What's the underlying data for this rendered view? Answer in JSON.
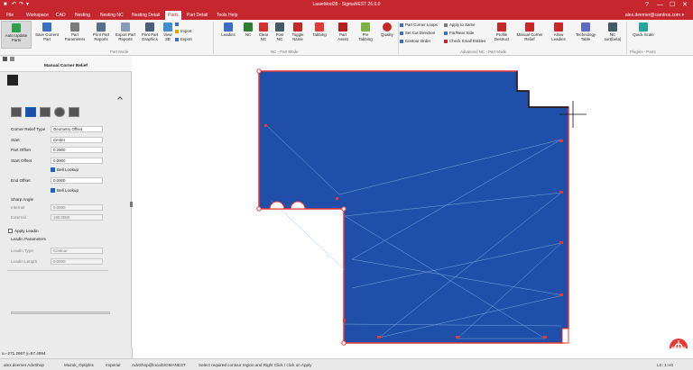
{
  "titlebar": {
    "title": "LaserMod28 - SigmaNEST 26.0.0",
    "quick_access": [
      "■",
      "↶",
      "↷",
      "▾"
    ],
    "window_controls": [
      "?",
      "—",
      "☐",
      "✕"
    ]
  },
  "menu": {
    "tabs": [
      "File",
      "Workspace",
      "CAD",
      "Nesting",
      "Nesting NC",
      "Nesting Detail",
      "Parts",
      "Part Detail",
      "Tools Help"
    ],
    "active_tab": "Parts",
    "account": "alex.deemer@camtrox.com ▾"
  },
  "ribbon": {
    "part_mode": {
      "auto_update": "Auto Update Parts",
      "save_current": "Save Current Part",
      "part_parameters": "Part Parameters",
      "print_part_reports": "Print Part Reports",
      "export_part_reports": "Export Part Reports",
      "print_part_graphics": "Print Part Graphics",
      "view_3d": "View 3D",
      "import": "Import",
      "export": "Export",
      "group_label": "Part Mode"
    },
    "nc_part_mode": {
      "leadins": "Leadins",
      "nc": "NC",
      "clear_nc": "Clear NC",
      "post_nc": "Post NC",
      "toggle_name": "Toggle Name",
      "tabbing": "Tabbing",
      "part_assist": "Part Assist",
      "pre_tabbing": "Pre Tabbing",
      "quality": "Quality",
      "group_label": "NC - Part Mode"
    },
    "advanced_nc": {
      "part_corner_loops": "Part Corner Loops",
      "set_cut_direction": "Set Cut Direction",
      "contour_order": "Contour Order",
      "apply_to_same": "Apply to Same",
      "far_near_side": "Far/Near Side",
      "check_small_entities": "Check Small Entities",
      "profile_destruct": "Profile Destruct",
      "manual_corner_relief": "Manual Corner Relief",
      "allow_leadins": "Allow Leadins",
      "technology_table": "Technology Table",
      "nc_sort_beta": "NC sort(beta)",
      "group_label": "Advanced NC - Part Mode"
    },
    "plugins": {
      "quick_scale": "Quick Scale",
      "group_label": "Plugins - Parts"
    }
  },
  "panel": {
    "title": "Manual Corner Relief",
    "corner_relief_type_label": "Corner Relief Type",
    "corner_relief_type_value": "Geometry Offset",
    "start_label": "Start",
    "start_value": "Center",
    "part_offset_label": "Part Offset",
    "part_offset_value": "0.2500",
    "start_offset_label": "Start Offset",
    "start_offset_value": "0.0000",
    "bell_lookup_label": "Bell Lookup",
    "end_offset_label": "End Offset",
    "end_offset_value": "0.0000",
    "bell_lookup2_label": "Bell Lookup",
    "sharp_angle_label": "Sharp Angle",
    "internal_label": "Internal",
    "internal_value": "0.0000",
    "external_label": "External",
    "external_value": "180.0000",
    "apply_leadin_label": "Apply Leadin",
    "leadin_parameters_label": "Leadin Parameters",
    "leadin_type_label": "Leadin Type",
    "leadin_type_value": "Contour",
    "leadin_length_label": "Leadin Length",
    "leadin_length_value": "0.0000",
    "bell_lookup_checked": true,
    "bell_lookup2_checked": true,
    "apply_leadin_checked": false
  },
  "status": {
    "coords": "x=-271.2667 y=57.4994",
    "user": "alex.deemer AdvShop",
    "machine": "Mazak_Optiplex",
    "units": "Imperial",
    "workspace": "AdvShop@localSIGMANEST",
    "hint": "Select required contour region and Right Click / click on Apply",
    "zoom": "LS: 1:∞0"
  },
  "colors": {
    "accent": "#c6262e",
    "part_fill": "#1f4fa8",
    "part_outline": "#e53935"
  }
}
